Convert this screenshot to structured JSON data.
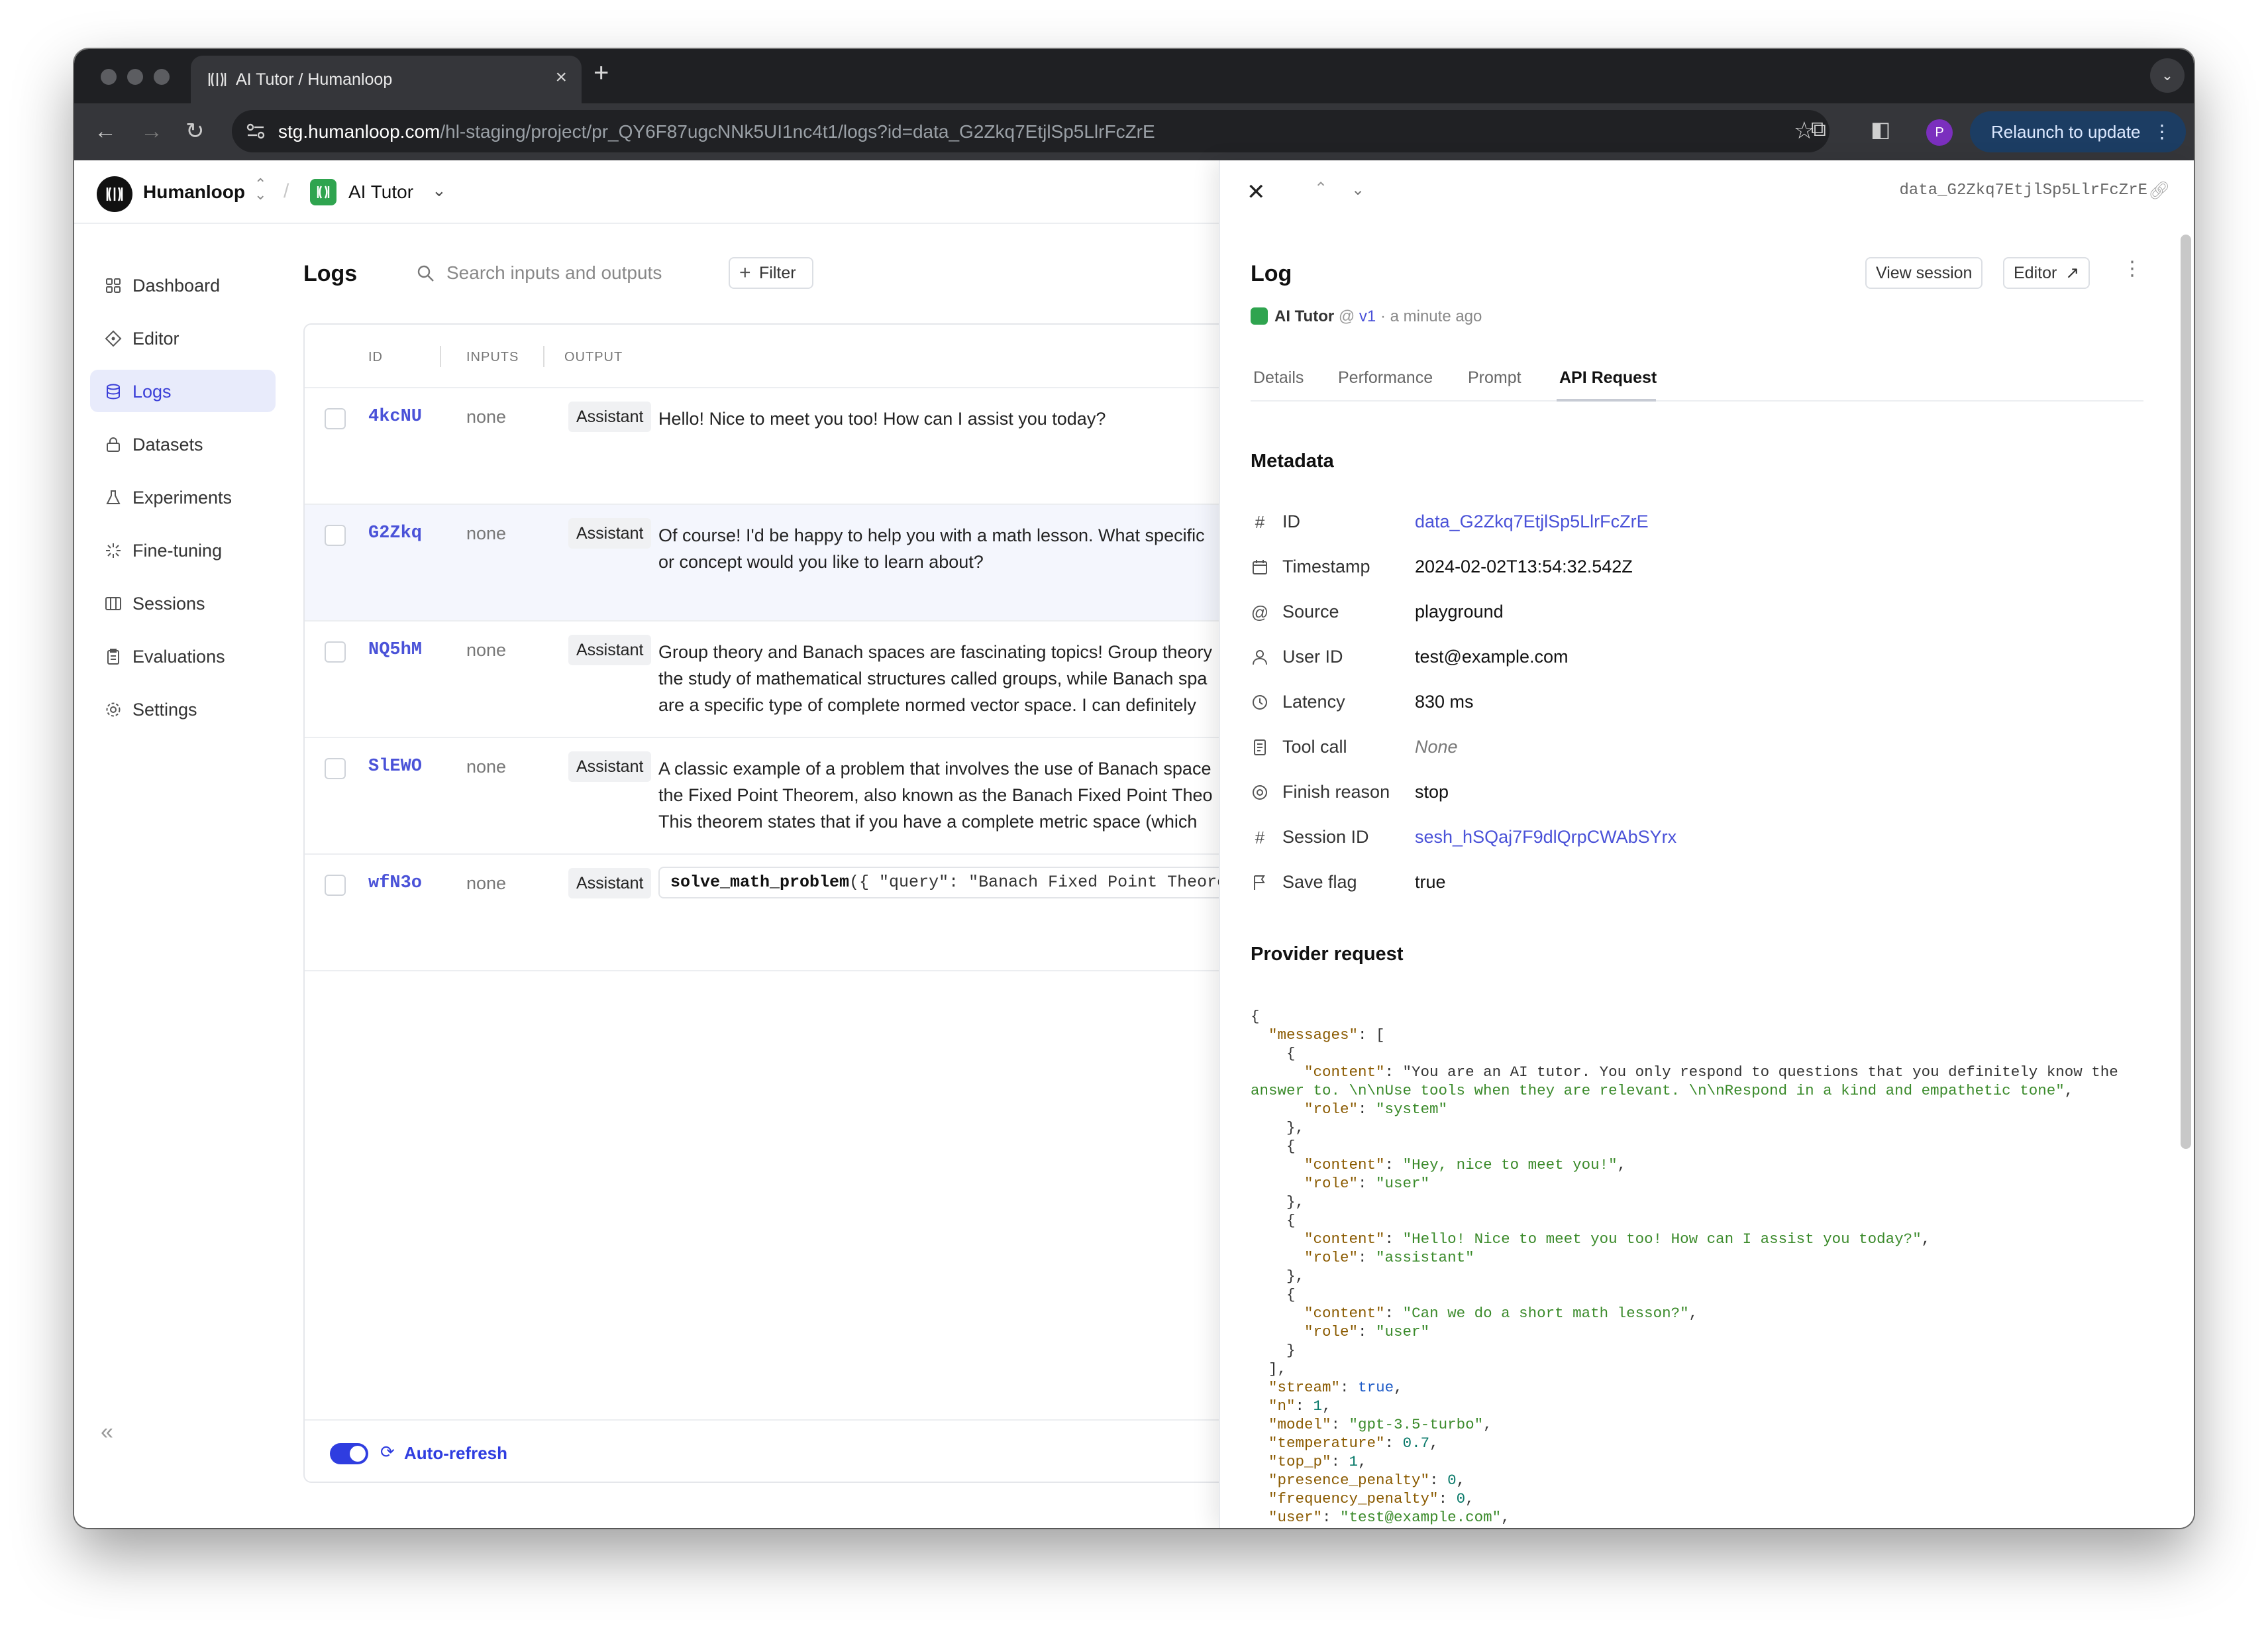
{
  "browser": {
    "tab_title": "AI Tutor / Humanloop",
    "url_host": "stg.humanloop.com",
    "url_path": "/hl-staging/project/pr_QY6F87ugcNNk5UI1nc4t1/logs?id=data_G2Zkq7EtjlSp5LlrFcZrE",
    "profile_initial": "P",
    "relaunch_label": "Relaunch to update"
  },
  "topbar": {
    "org_name": "Humanloop",
    "project_name": "AI Tutor"
  },
  "sidebar": {
    "items": [
      {
        "label": "Dashboard",
        "icon": "grid-icon"
      },
      {
        "label": "Editor",
        "icon": "diamond-icon"
      },
      {
        "label": "Logs",
        "icon": "database-icon",
        "active": true
      },
      {
        "label": "Datasets",
        "icon": "lock-icon"
      },
      {
        "label": "Experiments",
        "icon": "flask-icon"
      },
      {
        "label": "Fine-tuning",
        "icon": "sparkle-icon"
      },
      {
        "label": "Sessions",
        "icon": "columns-icon"
      },
      {
        "label": "Evaluations",
        "icon": "clipboard-icon"
      },
      {
        "label": "Settings",
        "icon": "gear-icon"
      }
    ]
  },
  "logs": {
    "title": "Logs",
    "search_placeholder": "Search inputs and outputs",
    "filter_label": "Filter",
    "columns": {
      "id": "ID",
      "inputs": "INPUTS",
      "output": "OUTPUT"
    },
    "rows": [
      {
        "id": "4kcNU",
        "inputs": "none",
        "role": "Assistant",
        "output": [
          "Hello! Nice to meet you too! How can I assist you today?"
        ]
      },
      {
        "id": "G2Zkq",
        "inputs": "none",
        "role": "Assistant",
        "output": [
          "Of course! I'd be happy to help you with a math lesson. What specific",
          "or concept would you like to learn about?"
        ],
        "selected": true
      },
      {
        "id": "NQ5hM",
        "inputs": "none",
        "role": "Assistant",
        "output": [
          "Group theory and Banach spaces are fascinating topics! Group theory",
          "the study of mathematical structures called groups, while Banach spa",
          "are a specific type of complete normed vector space. I can definitely"
        ]
      },
      {
        "id": "SlEWO",
        "inputs": "none",
        "role": "Assistant",
        "output": [
          "A classic example of a problem that involves the use of Banach space",
          "the Fixed Point Theorem, also known as the Banach Fixed Point Theo",
          "This theorem states that if you have a complete metric space (which"
        ]
      },
      {
        "id": "wfN3o",
        "inputs": "none",
        "role": "Assistant",
        "code_fn": "solve_math_problem",
        "code_rest": "({ \"query\": \"Banach Fixed Point Theorem"
      }
    ],
    "auto_refresh_label": "Auto-refresh",
    "auto_refresh_on": true
  },
  "drawer": {
    "log_id": "data_G2Zkq7EtjlSp5LlrFcZrE",
    "title": "Log",
    "view_session_label": "View session",
    "editor_label": "Editor",
    "project": "AI Tutor",
    "version": "v1",
    "time_ago": "a minute ago",
    "tabs": [
      "Details",
      "Performance",
      "Prompt",
      "API Request"
    ],
    "active_tab": "API Request",
    "metadata_title": "Metadata",
    "metadata": [
      {
        "icon": "hash-icon",
        "key": "ID",
        "value": "data_G2Zkq7EtjlSp5LlrFcZrE",
        "style": "link"
      },
      {
        "icon": "calendar-icon",
        "key": "Timestamp",
        "value": "2024-02-02T13:54:32.542Z",
        "style": "plain"
      },
      {
        "icon": "at-icon",
        "key": "Source",
        "value": "playground",
        "style": "plain"
      },
      {
        "icon": "user-icon",
        "key": "User ID",
        "value": "test@example.com",
        "style": "plain"
      },
      {
        "icon": "clock-icon",
        "key": "Latency",
        "value": "830 ms",
        "style": "plain"
      },
      {
        "icon": "document-icon",
        "key": "Tool call",
        "value": "None",
        "style": "muted"
      },
      {
        "icon": "target-icon",
        "key": "Finish reason",
        "value": "stop",
        "style": "plain"
      },
      {
        "icon": "hash-icon",
        "key": "Session ID",
        "value": "sesh_hSQaj7F9dlQrpCWAbSYrx",
        "style": "link"
      },
      {
        "icon": "flag-icon",
        "key": "Save flag",
        "value": "true",
        "style": "plain"
      }
    ],
    "provider_title": "Provider request",
    "provider_request_lines": [
      "{",
      "  \"messages\": [",
      "    {",
      "      \"content\": \"You are an AI tutor. You only respond to questions that you definitely know the",
      "answer to. \\n\\nUse tools when they are relevant. \\n\\nRespond in a kind and empathetic tone\",",
      "      \"role\": \"system\"",
      "    },",
      "    {",
      "      \"content\": \"Hey, nice to meet you!\",",
      "      \"role\": \"user\"",
      "    },",
      "    {",
      "      \"content\": \"Hello! Nice to meet you too! How can I assist you today?\",",
      "      \"role\": \"assistant\"",
      "    },",
      "    {",
      "      \"content\": \"Can we do a short math lesson?\",",
      "      \"role\": \"user\"",
      "    }",
      "  ],",
      "  \"stream\": true,",
      "  \"n\": 1,",
      "  \"model\": \"gpt-3.5-turbo\",",
      "  \"temperature\": 0.7,",
      "  \"top_p\": 1,",
      "  \"presence_penalty\": 0,",
      "  \"frequency_penalty\": 0,",
      "  \"user\": \"test@example.com\","
    ]
  },
  "colors": {
    "accent": "#4a52d8",
    "toggle": "#2f3de0",
    "project_badge": "#2fa44f",
    "code_key": "#8a5a00",
    "code_string": "#3a8a2a"
  }
}
